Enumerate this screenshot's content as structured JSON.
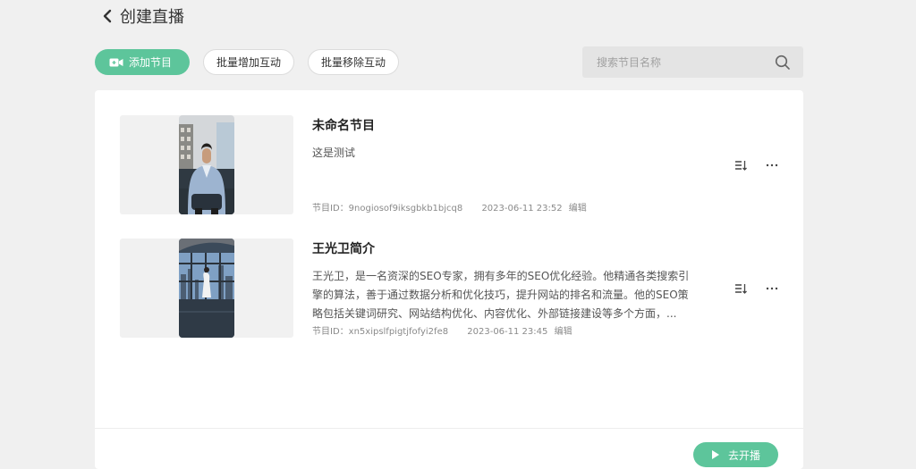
{
  "header": {
    "title": "创建直播"
  },
  "toolbar": {
    "add_label": "添加节目",
    "batch_add_label": "批量增加互动",
    "batch_remove_label": "批量移除互动"
  },
  "search": {
    "placeholder": "搜索节目名称"
  },
  "programs": [
    {
      "title": "未命名节目",
      "description": "这是测试",
      "id_label": "节目ID：",
      "id": "9nogiosof9iksgbkb1bjcq8",
      "time": "2023-06-11 23:52",
      "edit_label": "编辑"
    },
    {
      "title": "王光卫简介",
      "description": "王光卫，是一名资深的SEO专家，拥有多年的SEO优化经验。他精通各类搜索引擎的算法，善于通过数据分析和优化技巧，提升网站的排名和流量。他的SEO策略包括关键词研究、网站结构优化、内容优化、外部链接建设等多个方面，...",
      "id_label": "节目ID：",
      "id": "xn5xipslfpigtjfofyi2fe8",
      "time": "2023-06-11 23:45",
      "edit_label": "编辑"
    }
  ],
  "footer": {
    "go_live_label": "去开播"
  },
  "icons": {
    "back": "chevron-left-icon",
    "add": "video-add-icon",
    "search": "search-icon",
    "sort": "sort-icon",
    "more": "more-icon",
    "play": "play-icon"
  },
  "colors": {
    "accent": "#5dc59b"
  }
}
